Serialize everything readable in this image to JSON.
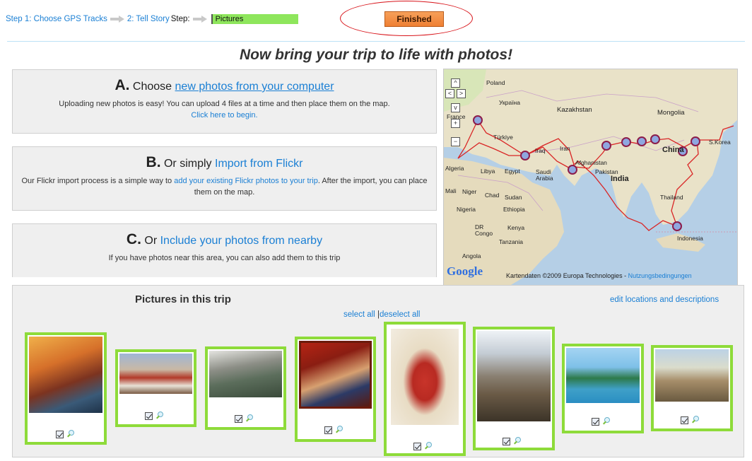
{
  "steps": {
    "step1": "Step 1: Choose GPS Tracks",
    "step2": "2: Tell Story",
    "step3": "Step",
    "step3_sep": ":",
    "pictures": "Pictures"
  },
  "finished_label": "Finished",
  "headline": "Now bring your trip to life with photos!",
  "options": {
    "a": {
      "letter": "A.",
      "prefix": "Choose",
      "link": "new photos from your computer",
      "desc": "Uploading new photos is easy! You can upload 4 files at a time and then place them on the map.",
      "desc_link": "Click here to begin."
    },
    "b": {
      "letter": "B.",
      "prefix": "Or simply",
      "link": "Import from Flickr",
      "desc_before": "Our Flickr import process is a simple way to",
      "desc_link": "add your existing Flickr photos to your trip",
      "desc_after": ". After the import, you can place them on the map."
    },
    "c": {
      "letter": "C.",
      "prefix": "Or",
      "link": "Include your photos from nearby",
      "desc": "If you have photos near this area, you can also add them to this trip"
    }
  },
  "map": {
    "labels": {
      "poland": "Poland",
      "ukraine": "Україна",
      "kazakhstan": "Kazakhstan",
      "mongolia": "Mongolia",
      "turkey": "Türkiye",
      "iraq": "Iraq",
      "iran": "Iran",
      "afghanistan": "Afghanistan",
      "pakistan": "Pakistan",
      "china": "China",
      "skorea": "S.Korea",
      "algeria": "Algeria",
      "libya": "Libya",
      "egypt": "Egypt",
      "saudi": "Saudi Arabia",
      "india": "India",
      "mali": "Mali",
      "niger": "Niger",
      "chad": "Chad",
      "sudan": "Sudan",
      "thailand": "Thailand",
      "nigeria": "Nigeria",
      "ethiopia": "Ethiopia",
      "drcongo": "DR Congo",
      "kenya": "Kenya",
      "tanzania": "Tanzania",
      "indonesia": "Indonesia",
      "angola": "Angola",
      "france": "France"
    },
    "google": "Google",
    "copyright": "Kartendaten ©2009 Europa Technologies -",
    "terms": "Nutzungsbedingungen",
    "zoom_in": "+",
    "zoom_out": "−"
  },
  "pictures": {
    "title": "Pictures in this trip",
    "select_all": "select all",
    "separator": "|",
    "deselect_all": "deselect all",
    "edit": "edit locations and descriptions"
  }
}
